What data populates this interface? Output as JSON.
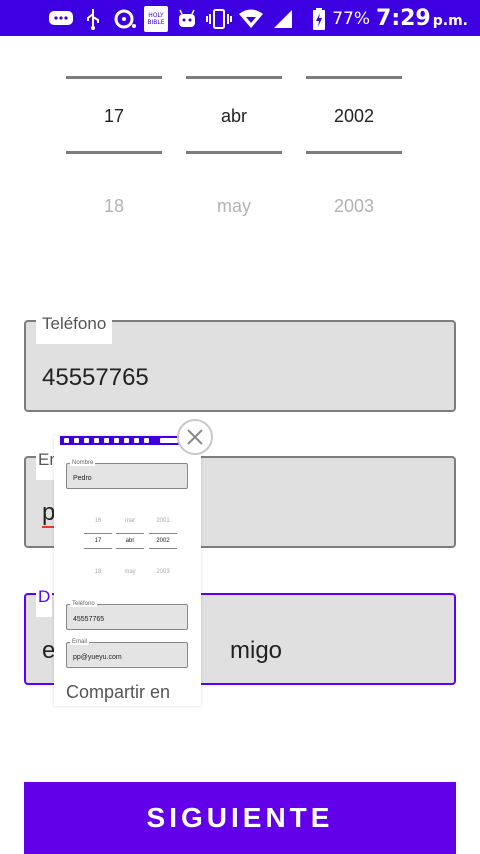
{
  "status_bar": {
    "battery_percent": "77%",
    "time": "7:29",
    "ampm": "p.m.",
    "bible_icon_text": "HOLY BIBLE",
    "icons": [
      "chat-icon",
      "usb-icon",
      "lens-icon",
      "holy-bible-icon",
      "robot-icon",
      "vibrate-icon",
      "wifi-icon",
      "signal-icon",
      "battery-icon"
    ]
  },
  "date_picker": {
    "day": {
      "selected": "17",
      "next": "18"
    },
    "month": {
      "selected": "abr",
      "next": "may"
    },
    "year": {
      "selected": "2002",
      "next": "2003"
    }
  },
  "fields": {
    "phone": {
      "label": "Teléfono",
      "value": "45557765"
    },
    "email": {
      "label": "Em",
      "value": "p"
    },
    "description": {
      "label": "D",
      "value": "e",
      "value_tail": "migo"
    }
  },
  "share_overlay": {
    "label": "Compartir en",
    "preview": {
      "name_label": "Nombre",
      "name_value": "Pedro",
      "prev_row": [
        "16",
        "mar",
        "2001"
      ],
      "sel_row": [
        "17",
        "abr",
        "2002"
      ],
      "next_row": [
        "18",
        "may",
        "2003"
      ],
      "phone_label": "Teléfono",
      "phone_value": "45557765",
      "email_label": "Email",
      "email_value": "pp@yueyu.com"
    }
  },
  "next_button": {
    "label": "SIGUIENTE"
  },
  "colors": {
    "status_bar": "#3d00e0",
    "accent": "#6200ea",
    "field_bg": "#e0e0e0"
  }
}
